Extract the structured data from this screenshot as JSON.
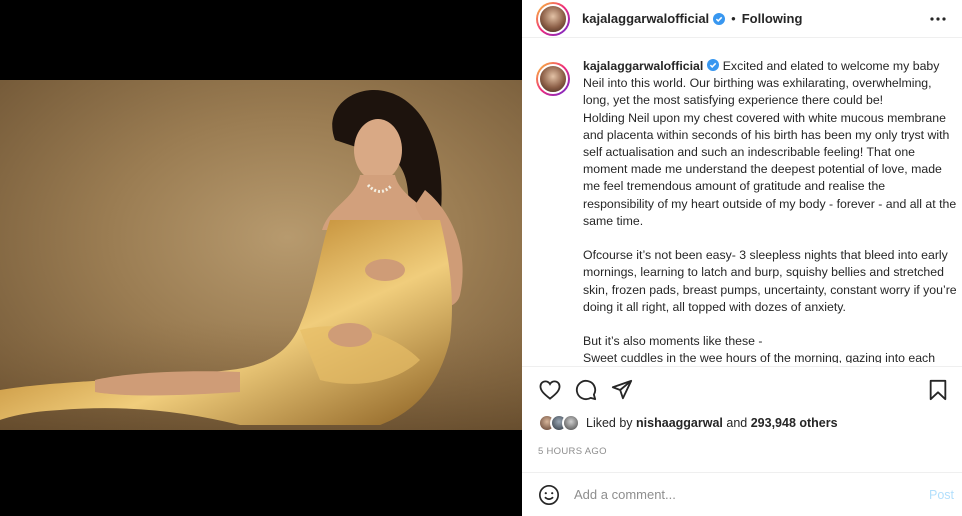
{
  "header": {
    "username": "kajalaggarwalofficial",
    "dot": "•",
    "follow_status": "Following",
    "more_icon": "more-horizontal-icon"
  },
  "caption": {
    "username": "kajalaggarwalofficial",
    "text": "Excited and elated to welcome my baby Neil into this world. Our birthing was exhilarating, overwhelming, long, yet the most satisfying experience there could be!\nHolding Neil upon my chest covered with white mucous membrane and placenta within seconds of his birth has been my only tryst with self actualisation and such an indescribable feeling! That one moment made me understand the deepest potential of love, made me feel tremendous amount of gratitude and realise the responsibility of my heart outside of my body - forever - and all at the same time.\n\nOfcourse it’s not been easy- 3 sleepless nights that bleed into early mornings, learning to latch and burp, squishy bellies and stretched skin, frozen pads, breast pumps, uncertainty, constant worry if you’re doing it all right, all topped with dozes of anxiety.\n\nBut it’s also moments like these -\nSweet cuddles in the wee hours of the morning, gazing into each"
  },
  "actions": {
    "icons": [
      "heart-icon",
      "comment-icon",
      "share-icon",
      "bookmark-icon"
    ]
  },
  "likes": {
    "prefix": "Liked by",
    "user": "nishaaggarwal",
    "and": "and",
    "count": "293,948 others"
  },
  "timestamp": "5 HOURS AGO",
  "comment_box": {
    "placeholder": "Add a comment...",
    "post_label": "Post"
  },
  "colors": {
    "verified": "#3897f0",
    "post_disabled": "#b2dffc",
    "muted": "#8e8e8e"
  }
}
